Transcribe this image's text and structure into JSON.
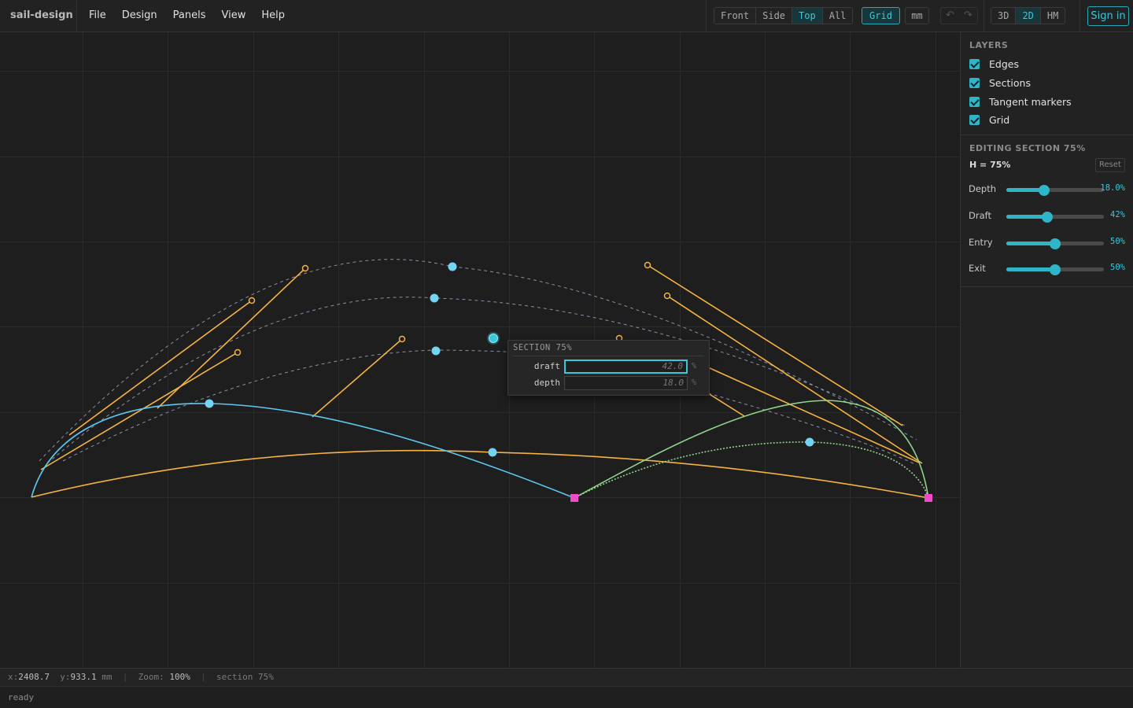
{
  "app": {
    "brand": "sail-design"
  },
  "menu": {
    "file": "File",
    "design": "Design",
    "panels": "Panels",
    "view": "View",
    "help": "Help"
  },
  "toolbar": {
    "views": [
      "Front",
      "Side",
      "Top",
      "All"
    ],
    "active_view": "Top",
    "grid": "Grid",
    "units": "mm",
    "undo_icon": "undo-icon",
    "redo_icon": "redo-icon",
    "modes": [
      "3D",
      "2D",
      "HM"
    ],
    "active_mode": "2D",
    "sign_in": "Sign in"
  },
  "layers": {
    "title": "LAYERS",
    "items": [
      {
        "label": "Edges",
        "checked": true
      },
      {
        "label": "Sections",
        "checked": true
      },
      {
        "label": "Tangent markers",
        "checked": true
      },
      {
        "label": "Grid",
        "checked": true
      }
    ]
  },
  "editing": {
    "title": "EDITING SECTION 75%",
    "height_label": "H = 75%",
    "reset": "Reset",
    "sliders": [
      {
        "label": "Depth",
        "value_text": "18.0%",
        "fraction": 0.39
      },
      {
        "label": "Draft",
        "value_text": "42%",
        "fraction": 0.42
      },
      {
        "label": "Entry",
        "value_text": "50%",
        "fraction": 0.5
      },
      {
        "label": "Exit",
        "value_text": "50%",
        "fraction": 0.5
      }
    ]
  },
  "popup": {
    "title": "SECTION 75%",
    "fields": [
      {
        "label": "draft",
        "value": "42.0",
        "unit": "%"
      },
      {
        "label": "depth",
        "value": "18.0",
        "unit": "%"
      }
    ]
  },
  "status": {
    "x_label": "x:",
    "x": "2408.7",
    "y_label": "y:",
    "y": "933.1",
    "unit": "mm",
    "zoom_label": "Zoom:",
    "zoom": "100%",
    "section": "section 75%",
    "message": "ready"
  },
  "colors": {
    "accent": "#38c8dc",
    "edge_orange": "#f5b342",
    "edge_blue": "#5ec8f0",
    "edge_green": "#8fd48a",
    "corner_magenta": "#f04cc8",
    "section_dashed": "#8a8fa8"
  }
}
